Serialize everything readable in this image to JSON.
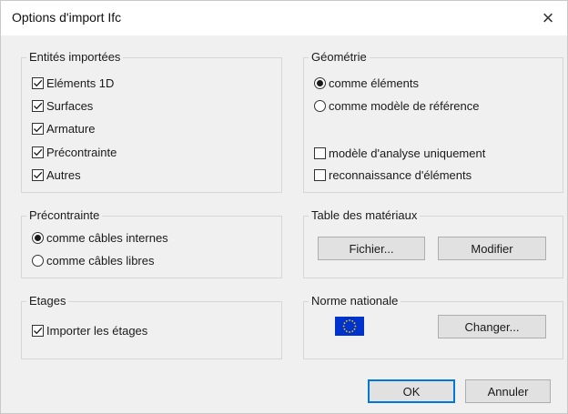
{
  "window": {
    "title": "Options d'import Ifc",
    "close_glyph": "×"
  },
  "entities": {
    "legend": "Entités importées",
    "items": [
      {
        "label": "Eléments 1D",
        "checked": true
      },
      {
        "label": "Surfaces",
        "checked": true
      },
      {
        "label": "Armature",
        "checked": true
      },
      {
        "label": "Précontrainte",
        "checked": true
      },
      {
        "label": "Autres",
        "checked": true
      }
    ]
  },
  "geometry": {
    "legend": "Géométrie",
    "radios": [
      {
        "label": "comme éléments",
        "selected": true
      },
      {
        "label": "comme modèle de référence",
        "selected": false
      }
    ],
    "checks": [
      {
        "label": "modèle d'analyse uniquement",
        "checked": false
      },
      {
        "label": "reconnaissance d'éléments",
        "checked": false
      }
    ]
  },
  "prestress": {
    "legend": "Précontrainte",
    "radios": [
      {
        "label": "comme câbles internes",
        "selected": true
      },
      {
        "label": "comme câbles libres",
        "selected": false
      }
    ]
  },
  "materials": {
    "legend": "Table des matériaux",
    "file_button": "Fichier...",
    "modify_button": "Modifier"
  },
  "floors": {
    "legend": "Etages",
    "import_label": "Importer les étages",
    "import_checked": true
  },
  "national_standard": {
    "legend": "Norme nationale",
    "flag_icon": "eu-flag-icon",
    "change_button": "Changer..."
  },
  "footer": {
    "ok_button": "OK",
    "cancel_button": "Annuler"
  },
  "colors": {
    "default_button_border": "#0078d7",
    "flag_blue": "#0033cc",
    "flag_stars": "#ffcc00"
  }
}
